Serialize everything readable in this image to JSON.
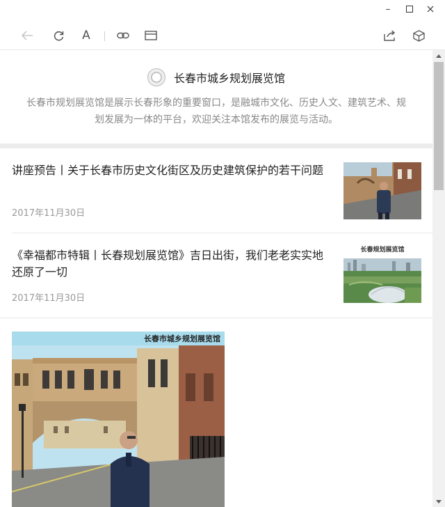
{
  "window": {
    "controls": {
      "minimize": "–",
      "maximize": "☐",
      "close": "✕"
    }
  },
  "toolbar": {
    "back_icon": "back-arrow-icon",
    "refresh_icon": "refresh-icon",
    "font_label": "A",
    "link_icon": "link-icon",
    "window_icon": "window-icon",
    "share_icon": "share-icon",
    "box_icon": "cube-icon"
  },
  "account": {
    "name": "长春市城乡规划展览馆",
    "description": "长春市规划展览馆是展示长春形象的重要窗口，是融城市文化、历史人文、建筑艺术、规划发展为一体的平台，欢迎关注本馆发布的展览与活动。"
  },
  "articles": [
    {
      "title": "讲座预告丨关于长春市历史文化街区及历史建筑保护的若干问题",
      "date": "2017年11月30日"
    },
    {
      "title": "《幸福都市特辑丨长春规划展览馆》吉日出街，我们老老实实地还原了一切",
      "date": "2017年11月30日",
      "thumb_caption": "长春规划展览馆"
    }
  ],
  "feature_image": {
    "caption": "长春市城乡规划展览馆"
  },
  "colors": {
    "accent_text": "#222222",
    "muted_text": "#999999",
    "band": "#ececec"
  }
}
